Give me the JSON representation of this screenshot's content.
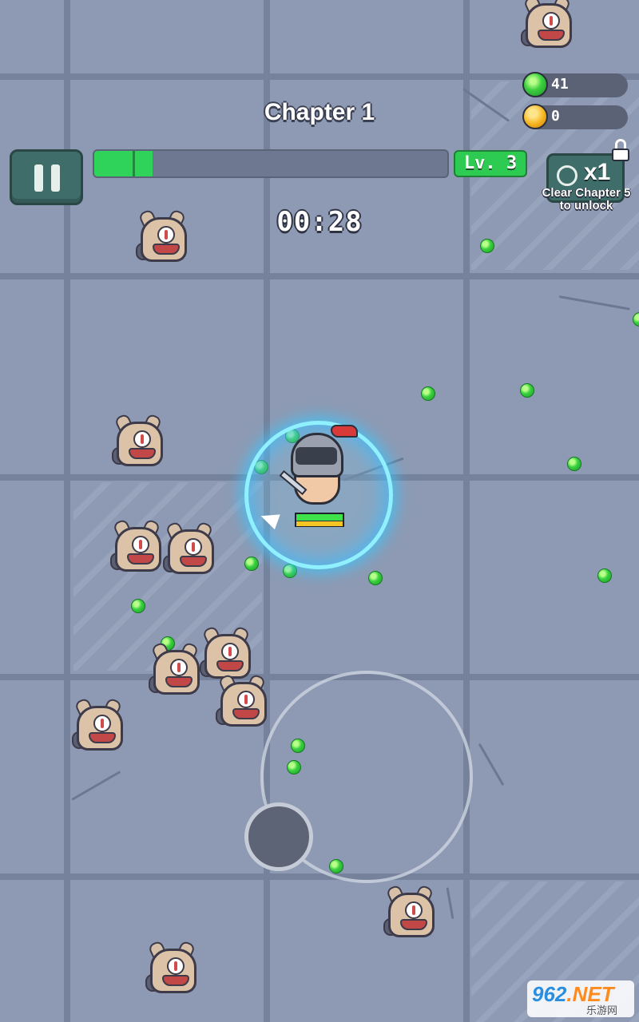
{
  "hud": {
    "chapter_title": "Chapter 1",
    "level_label": "Lv. 3",
    "timer": "00:28",
    "xp_progress": 0.165,
    "gems": "41",
    "coins": "0",
    "speed_label": "x1",
    "unlock_hint": "Clear Chapter 5 to unlock"
  },
  "hero": {
    "hp_fraction": 1.0,
    "xp_fraction": 1.0
  },
  "icons": {
    "pause": "pause-icon",
    "gem": "gem-icon",
    "coin": "coin-icon",
    "speed": "speed-clock-icon",
    "lock": "lock-icon"
  },
  "watermark": {
    "top": "962.NET",
    "bottom": "乐游网"
  },
  "colors": {
    "floor": "#8e9ab3",
    "button": "#3f6e6a",
    "xp_fill": "#2fd35a",
    "level_badge": "#2ecb52",
    "shield": "#8ff0ff"
  }
}
